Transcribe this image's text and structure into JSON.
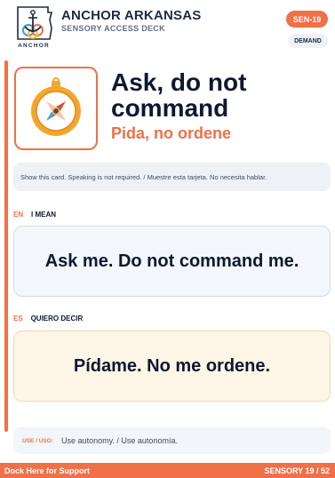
{
  "header": {
    "logo_text": "ANCHOR",
    "title": "ANCHOR ARKANSAS",
    "subtitle": "SENSORY ACCESS DECK",
    "code_badge": "SEN-19",
    "category_badge": "DEMAND"
  },
  "hero": {
    "icon": "compass-icon",
    "title": "Ask, do not command",
    "title_es": "Pida, no ordene"
  },
  "instruction": "Show this card. Speaking is not required. / Muestre esta tarjeta. No necesita hablar.",
  "en": {
    "lang": "EN",
    "label": "I MEAN",
    "text": "Ask me. Do not command me."
  },
  "es": {
    "lang": "ES",
    "label": "QUIERO DECIR",
    "text": "Pídame. No me ordene."
  },
  "use": {
    "label": "USE / USO:",
    "text": "Use autonomy. / Use autonomía."
  },
  "footer": {
    "left": "Dock Here for Support",
    "right": "SENSORY 19 / 52"
  },
  "colors": {
    "accent": "#f07048",
    "navy": "#1d2b45",
    "en_bg": "#f3f7fb",
    "es_bg": "#fff6e8"
  }
}
